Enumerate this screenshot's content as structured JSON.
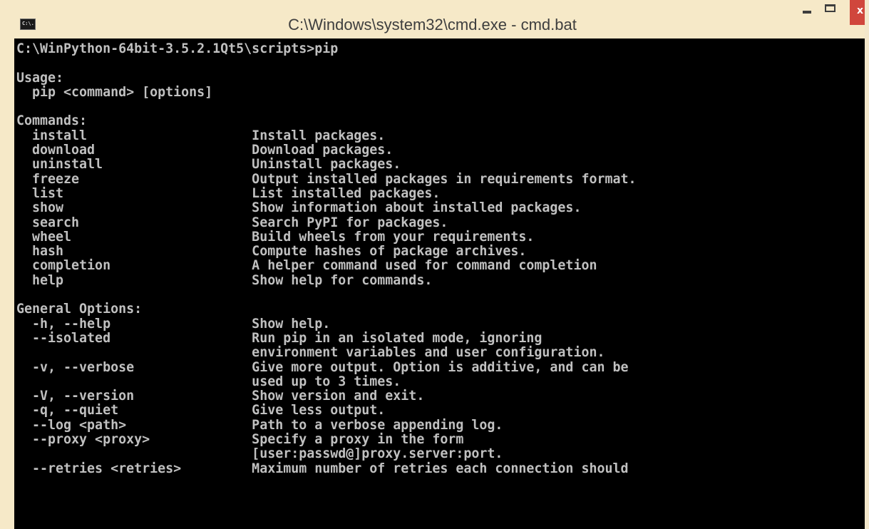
{
  "window": {
    "title": "C:\\Windows\\system32\\cmd.exe - cmd.bat",
    "icon_text": "C:\\.",
    "controls": {
      "minimize": "minimize-icon",
      "maximize": "maximize-icon",
      "close": "close-icon",
      "close_glyph": "x"
    }
  },
  "console": {
    "lines": [
      "C:\\WinPython-64bit-3.5.2.1Qt5\\scripts>pip",
      "",
      "Usage:",
      "  pip <command> [options]",
      "",
      "Commands:",
      "  install                     Install packages.",
      "  download                    Download packages.",
      "  uninstall                   Uninstall packages.",
      "  freeze                      Output installed packages in requirements format.",
      "  list                        List installed packages.",
      "  show                        Show information about installed packages.",
      "  search                      Search PyPI for packages.",
      "  wheel                       Build wheels from your requirements.",
      "  hash                        Compute hashes of package archives.",
      "  completion                  A helper command used for command completion",
      "  help                        Show help for commands.",
      "",
      "General Options:",
      "  -h, --help                  Show help.",
      "  --isolated                  Run pip in an isolated mode, ignoring",
      "                              environment variables and user configuration.",
      "  -v, --verbose               Give more output. Option is additive, and can be",
      "                              used up to 3 times.",
      "  -V, --version               Show version and exit.",
      "  -q, --quiet                 Give less output.",
      "  --log <path>                Path to a verbose appending log.",
      "  --proxy <proxy>             Specify a proxy in the form",
      "                              [user:passwd@]proxy.server:port.",
      "  --retries <retries>         Maximum number of retries each connection should"
    ]
  },
  "colors": {
    "console_bg": "#000000",
    "console_fg": "#c0c0c0",
    "titlebar_bg": "#f6e9c8",
    "close_bg": "#d0463c"
  }
}
